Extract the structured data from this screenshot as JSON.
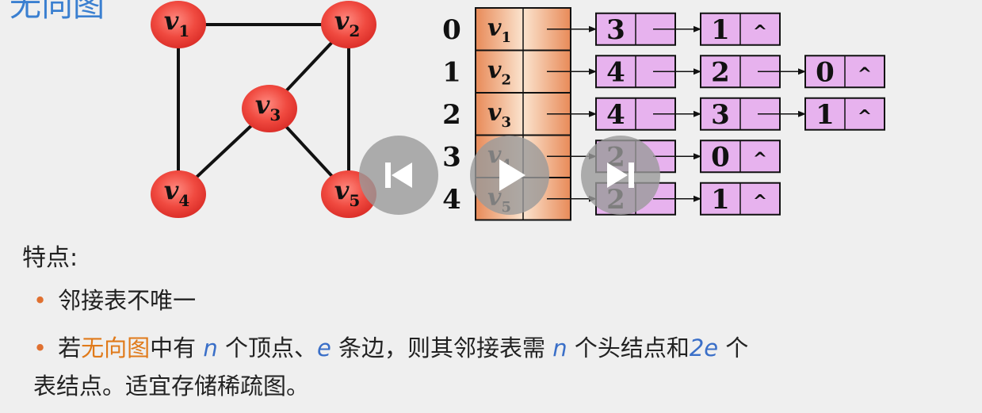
{
  "slide": {
    "title": "无向图"
  },
  "graph": {
    "vertices": [
      {
        "id": "v1",
        "name": "v",
        "sub": "1"
      },
      {
        "id": "v2",
        "name": "v",
        "sub": "2"
      },
      {
        "id": "v3",
        "name": "v",
        "sub": "3"
      },
      {
        "id": "v4",
        "name": "v",
        "sub": "4"
      },
      {
        "id": "v5",
        "name": "v",
        "sub": "5"
      }
    ],
    "edges": [
      [
        "v1",
        "v2"
      ],
      [
        "v1",
        "v4"
      ],
      [
        "v2",
        "v3"
      ],
      [
        "v2",
        "v5"
      ],
      [
        "v3",
        "v4"
      ],
      [
        "v3",
        "v5"
      ]
    ]
  },
  "adjacency": {
    "rows": [
      {
        "index": "0",
        "name": "v",
        "sub": "1",
        "nodes": [
          "3",
          "1"
        ]
      },
      {
        "index": "1",
        "name": "v",
        "sub": "2",
        "nodes": [
          "4",
          "2",
          "0"
        ]
      },
      {
        "index": "2",
        "name": "v",
        "sub": "3",
        "nodes": [
          "4",
          "3",
          "1"
        ]
      },
      {
        "index": "3",
        "name": "v",
        "sub": "4",
        "nodes": [
          "2",
          "0"
        ]
      },
      {
        "index": "4",
        "name": "v",
        "sub": "5",
        "nodes": [
          "2",
          "1"
        ]
      }
    ],
    "null_symbol": "^"
  },
  "notes": {
    "heading": "特点:",
    "bullet_symbol": "•",
    "bullet1": "邻接表不唯一",
    "bullet2": {
      "p1": "若",
      "highlight": "无向图",
      "p2": "中有 ",
      "var_n": "n",
      "p3": " 个顶点、",
      "var_e": "e",
      "p4": " 条边，则其邻接表需 ",
      "var_n2": "n",
      "p5": " 个头结点和",
      "var_2e": "2e",
      "p6": " 个",
      "line2": "表结点。适宜存储稀疏图。"
    }
  },
  "colors": {
    "vertex_fill": "#e8322e",
    "head_fill_light": "#fbe0c8",
    "head_fill_dark": "#e88a58",
    "node_fill": "#e7b2ee",
    "node_border": "#222222",
    "highlight_orange": "#e07a1a",
    "variable_blue": "#3a6fc8"
  },
  "player": {
    "prev_icon": "skip-back-icon",
    "play_icon": "play-icon",
    "next_icon": "skip-forward-icon"
  }
}
